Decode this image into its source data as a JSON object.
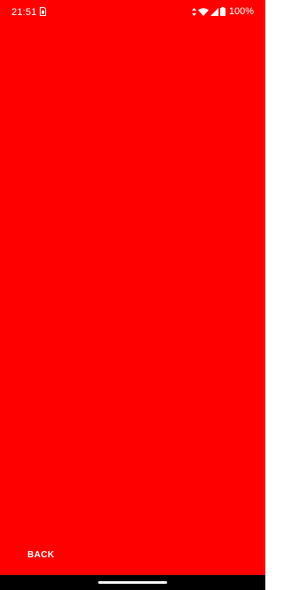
{
  "status_bar": {
    "time": "21:51",
    "battery": "100%",
    "icons": [
      "sim-card-icon",
      "data-arrows-icon",
      "wifi-icon",
      "cell-signal-icon",
      "battery-icon"
    ]
  },
  "screen": {
    "background_color": "#ff0000"
  },
  "actions": {
    "back_label": "BACK"
  },
  "nav_bar": {
    "background_color": "#000000"
  }
}
